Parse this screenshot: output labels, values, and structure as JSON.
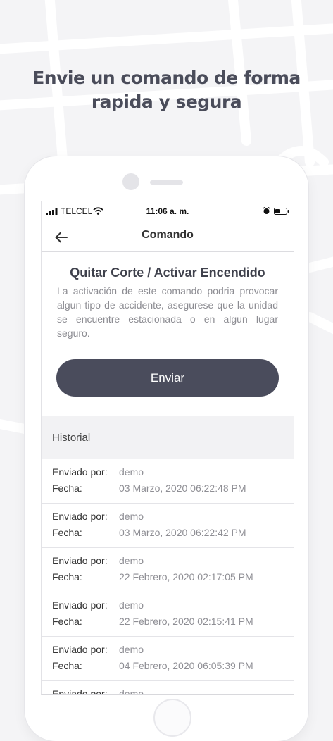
{
  "headline": {
    "line1": "Envie un comando de forma",
    "line2": "rapida y segura"
  },
  "status_bar": {
    "carrier": "TELCEL",
    "time": "11:06 a. m.",
    "icons": [
      "signal-icon",
      "wifi-icon",
      "alarm-icon",
      "battery-icon"
    ]
  },
  "nav": {
    "title": "Comando",
    "back_icon": "arrow-left-icon"
  },
  "command": {
    "title": "Quitar Corte / Activar Encendido",
    "description": "La activación de este comando podria provocar algun tipo de accidente, asegurese que la unidad se encuentre estacionada o en algun lugar seguro.",
    "send_label": "Enviar"
  },
  "history": {
    "title": "Historial",
    "sent_by_label": "Enviado por:",
    "date_label": "Fecha:",
    "items": [
      {
        "sent_by": "demo",
        "date": "03 Marzo, 2020 06:22:48 PM"
      },
      {
        "sent_by": "demo",
        "date": "03 Marzo, 2020 06:22:42 PM"
      },
      {
        "sent_by": "demo",
        "date": "22 Febrero, 2020 02:17:05 PM"
      },
      {
        "sent_by": "demo",
        "date": "22 Febrero, 2020 02:15:41 PM"
      },
      {
        "sent_by": "demo",
        "date": "04 Febrero, 2020 06:05:39 PM"
      },
      {
        "sent_by": "demo",
        "date": ""
      }
    ]
  },
  "colors": {
    "accent": "#4a4c5c",
    "background": "#f4f4f6",
    "headline": "#4a4c5a"
  }
}
